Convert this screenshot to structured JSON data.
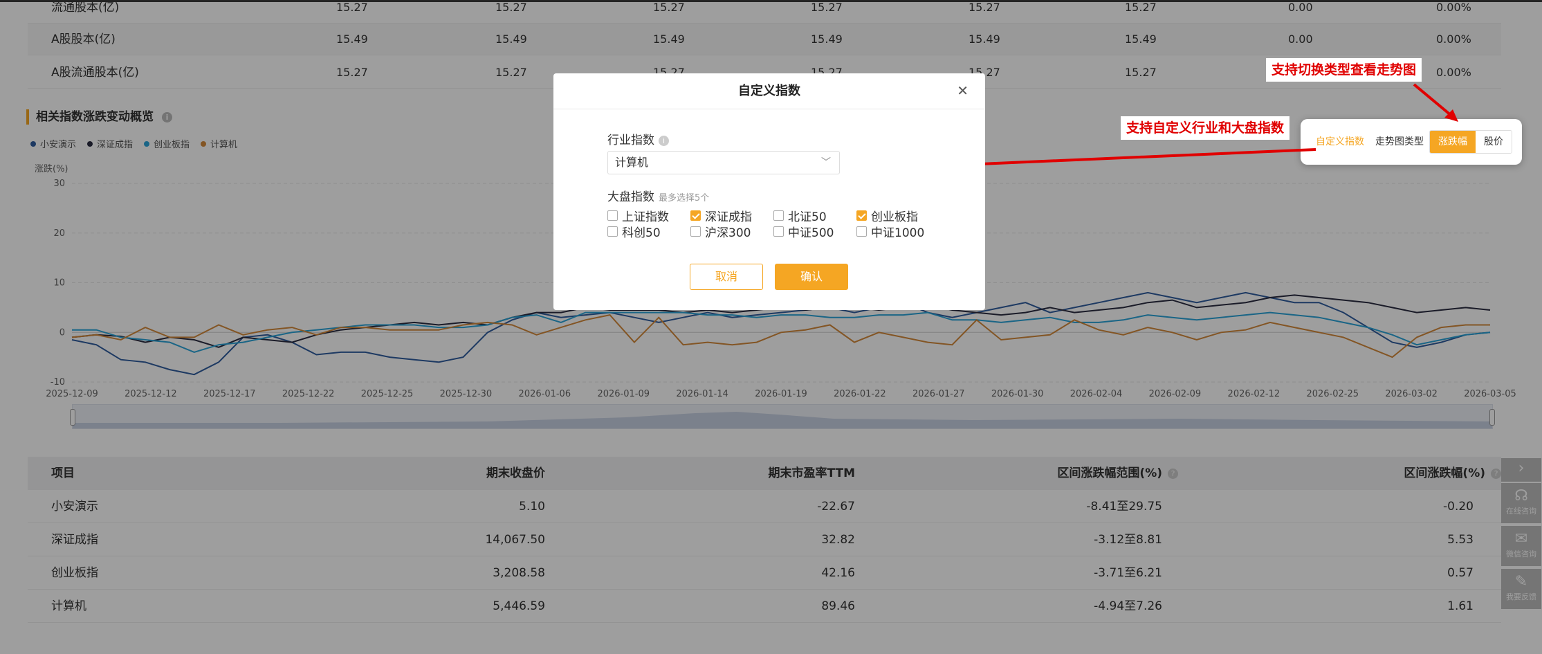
{
  "top_table": {
    "rows": [
      {
        "label": "流通股本(亿)",
        "values": [
          "15.27",
          "15.27",
          "15.27",
          "15.27",
          "15.27",
          "15.27",
          "0.00",
          "0.00%"
        ]
      },
      {
        "label": "A股股本(亿)",
        "values": [
          "15.49",
          "15.49",
          "15.49",
          "15.49",
          "15.49",
          "15.49",
          "0.00",
          "0.00%"
        ]
      },
      {
        "label": "A股流通股本(亿)",
        "values": [
          "15.27",
          "15.27",
          "15.27",
          "15.27",
          "15.27",
          "15.27",
          "0.00",
          "0.00%"
        ]
      }
    ]
  },
  "section": {
    "title": "相关指数涨跌变动概览",
    "info": "i"
  },
  "chart_data": {
    "type": "line",
    "ylabel": "涨跌(%)",
    "ylim": [
      -10,
      30
    ],
    "yticks": [
      "30",
      "20",
      "10",
      "0",
      "-10"
    ],
    "grid": true,
    "legend_position": "top-left",
    "x_tick_labels": [
      "2025-12-09",
      "2025-12-12",
      "2025-12-17",
      "2025-12-22",
      "2025-12-25",
      "2025-12-30",
      "2026-01-06",
      "2026-01-09",
      "2026-01-14",
      "2026-01-19",
      "2026-01-22",
      "2026-01-27",
      "2026-01-30",
      "2026-02-04",
      "2026-02-09",
      "2026-02-12",
      "2026-02-25",
      "2026-03-02",
      "2026-03-05"
    ],
    "series": [
      {
        "name": "小安演示",
        "color": "#2f5d9e",
        "values": [
          -1.5,
          -2.5,
          -5.5,
          -6,
          -7.5,
          -8.5,
          -6,
          -1,
          -0.5,
          -2,
          -4.5,
          -4,
          -4,
          -5,
          -5.5,
          -6,
          -5,
          0,
          2.5,
          4,
          3,
          3.5,
          4,
          3,
          2,
          3,
          4,
          3,
          3.5,
          4,
          4.5,
          5,
          4,
          5,
          6,
          4,
          3,
          4,
          5,
          6,
          4,
          5,
          6,
          7,
          8,
          7,
          6,
          7,
          8,
          7,
          6,
          6,
          4,
          1,
          -2,
          -3,
          -2,
          -0.5,
          0
        ]
      },
      {
        "name": "深证成指",
        "color": "#2b2d42",
        "values": [
          -1,
          -0.5,
          -0.8,
          -2,
          -1,
          -1.5,
          -3,
          -1,
          -1.5,
          -2,
          -0.5,
          0.5,
          1,
          1.5,
          2,
          1.5,
          2,
          1.5,
          3,
          4,
          4,
          5,
          4.5,
          4.5,
          4.5,
          4,
          4.5,
          4,
          4.5,
          5,
          4.5,
          5,
          5,
          4.5,
          5,
          5.5,
          4.5,
          4,
          3.5,
          4,
          5,
          4,
          4.5,
          5,
          6,
          6.5,
          5,
          5.5,
          6,
          7,
          7.5,
          7,
          6.5,
          6,
          5,
          4,
          4.5,
          5,
          4.5
        ]
      },
      {
        "name": "创业板指",
        "color": "#2aa4d8",
        "values": [
          0.5,
          0.5,
          -1,
          -1.5,
          -2,
          -4,
          -2.5,
          -2,
          -1,
          0,
          0.5,
          1,
          1.5,
          1.5,
          1.5,
          1,
          1,
          1.5,
          3,
          3.5,
          2,
          4,
          4,
          4,
          4,
          4,
          3.5,
          3.5,
          3,
          3.5,
          3.5,
          3,
          3,
          3.5,
          3.5,
          4,
          2.5,
          2.5,
          2,
          2.5,
          3,
          2,
          2,
          2.5,
          3.5,
          3,
          2.5,
          3,
          3.5,
          4,
          3.5,
          3,
          2,
          1,
          -0.5,
          -2.5,
          -1.5,
          -0.5,
          0
        ]
      },
      {
        "name": "计算机",
        "color": "#d4893a",
        "values": [
          -1,
          -0.5,
          -1.5,
          1,
          -1,
          -1,
          1.5,
          -0.5,
          0.5,
          1,
          -0.5,
          1,
          1,
          0.5,
          0.5,
          0.5,
          1.5,
          2,
          1.5,
          -0.5,
          1,
          2.5,
          3.5,
          -2,
          3,
          -2.5,
          -2,
          -2.5,
          -2,
          0,
          0.5,
          1.5,
          -2,
          0,
          -1,
          -2,
          -2.5,
          2.5,
          -1.5,
          -1,
          -0.5,
          2.5,
          0.5,
          -0.5,
          1,
          0,
          -1.5,
          0,
          0.5,
          2,
          1,
          0,
          -1,
          -3,
          -5,
          -1,
          1,
          1.5,
          1.5
        ]
      }
    ]
  },
  "bottom_table": {
    "headers": [
      "项目",
      "期末收盘价",
      "期末市盈率TTM",
      "区间涨跌幅范围(%)",
      "区间涨跌幅(%)"
    ],
    "rows": [
      [
        "小安演示",
        "5.10",
        "-22.67",
        "-8.41至29.75",
        "-0.20"
      ],
      [
        "深证成指",
        "14,067.50",
        "32.82",
        "-3.12至8.81",
        "5.53"
      ],
      [
        "创业板指",
        "3,208.58",
        "42.16",
        "-3.71至6.21",
        "0.57"
      ],
      [
        "计算机",
        "5,446.59",
        "89.46",
        "-4.94至7.26",
        "1.61"
      ]
    ]
  },
  "controls": {
    "custom_link": "自定义指数",
    "type_label": "走势图类型",
    "seg": [
      "涨跌幅",
      "股价"
    ]
  },
  "annotations": {
    "a1": "支持切换类型查看走势图",
    "a2": "支持自定义行业和大盘指数"
  },
  "side": {
    "online": "在线咨询",
    "wechat": "微信咨询",
    "feedback": "我要反馈"
  },
  "modal": {
    "title": "自定义指数",
    "industry_label": "行业指数",
    "industry_value": "计算机",
    "market_label": "大盘指数",
    "market_hint": "最多选择5个",
    "options": [
      {
        "label": "上证指数",
        "checked": false
      },
      {
        "label": "深证成指",
        "checked": true
      },
      {
        "label": "北证50",
        "checked": false
      },
      {
        "label": "创业板指",
        "checked": true
      },
      {
        "label": "科创50",
        "checked": false
      },
      {
        "label": "沪深300",
        "checked": false
      },
      {
        "label": "中证500",
        "checked": false
      },
      {
        "label": "中证1000",
        "checked": false
      }
    ],
    "cancel": "取消",
    "confirm": "确认"
  },
  "colors": {
    "accent": "#f5a623",
    "annotation": "#e00000"
  }
}
